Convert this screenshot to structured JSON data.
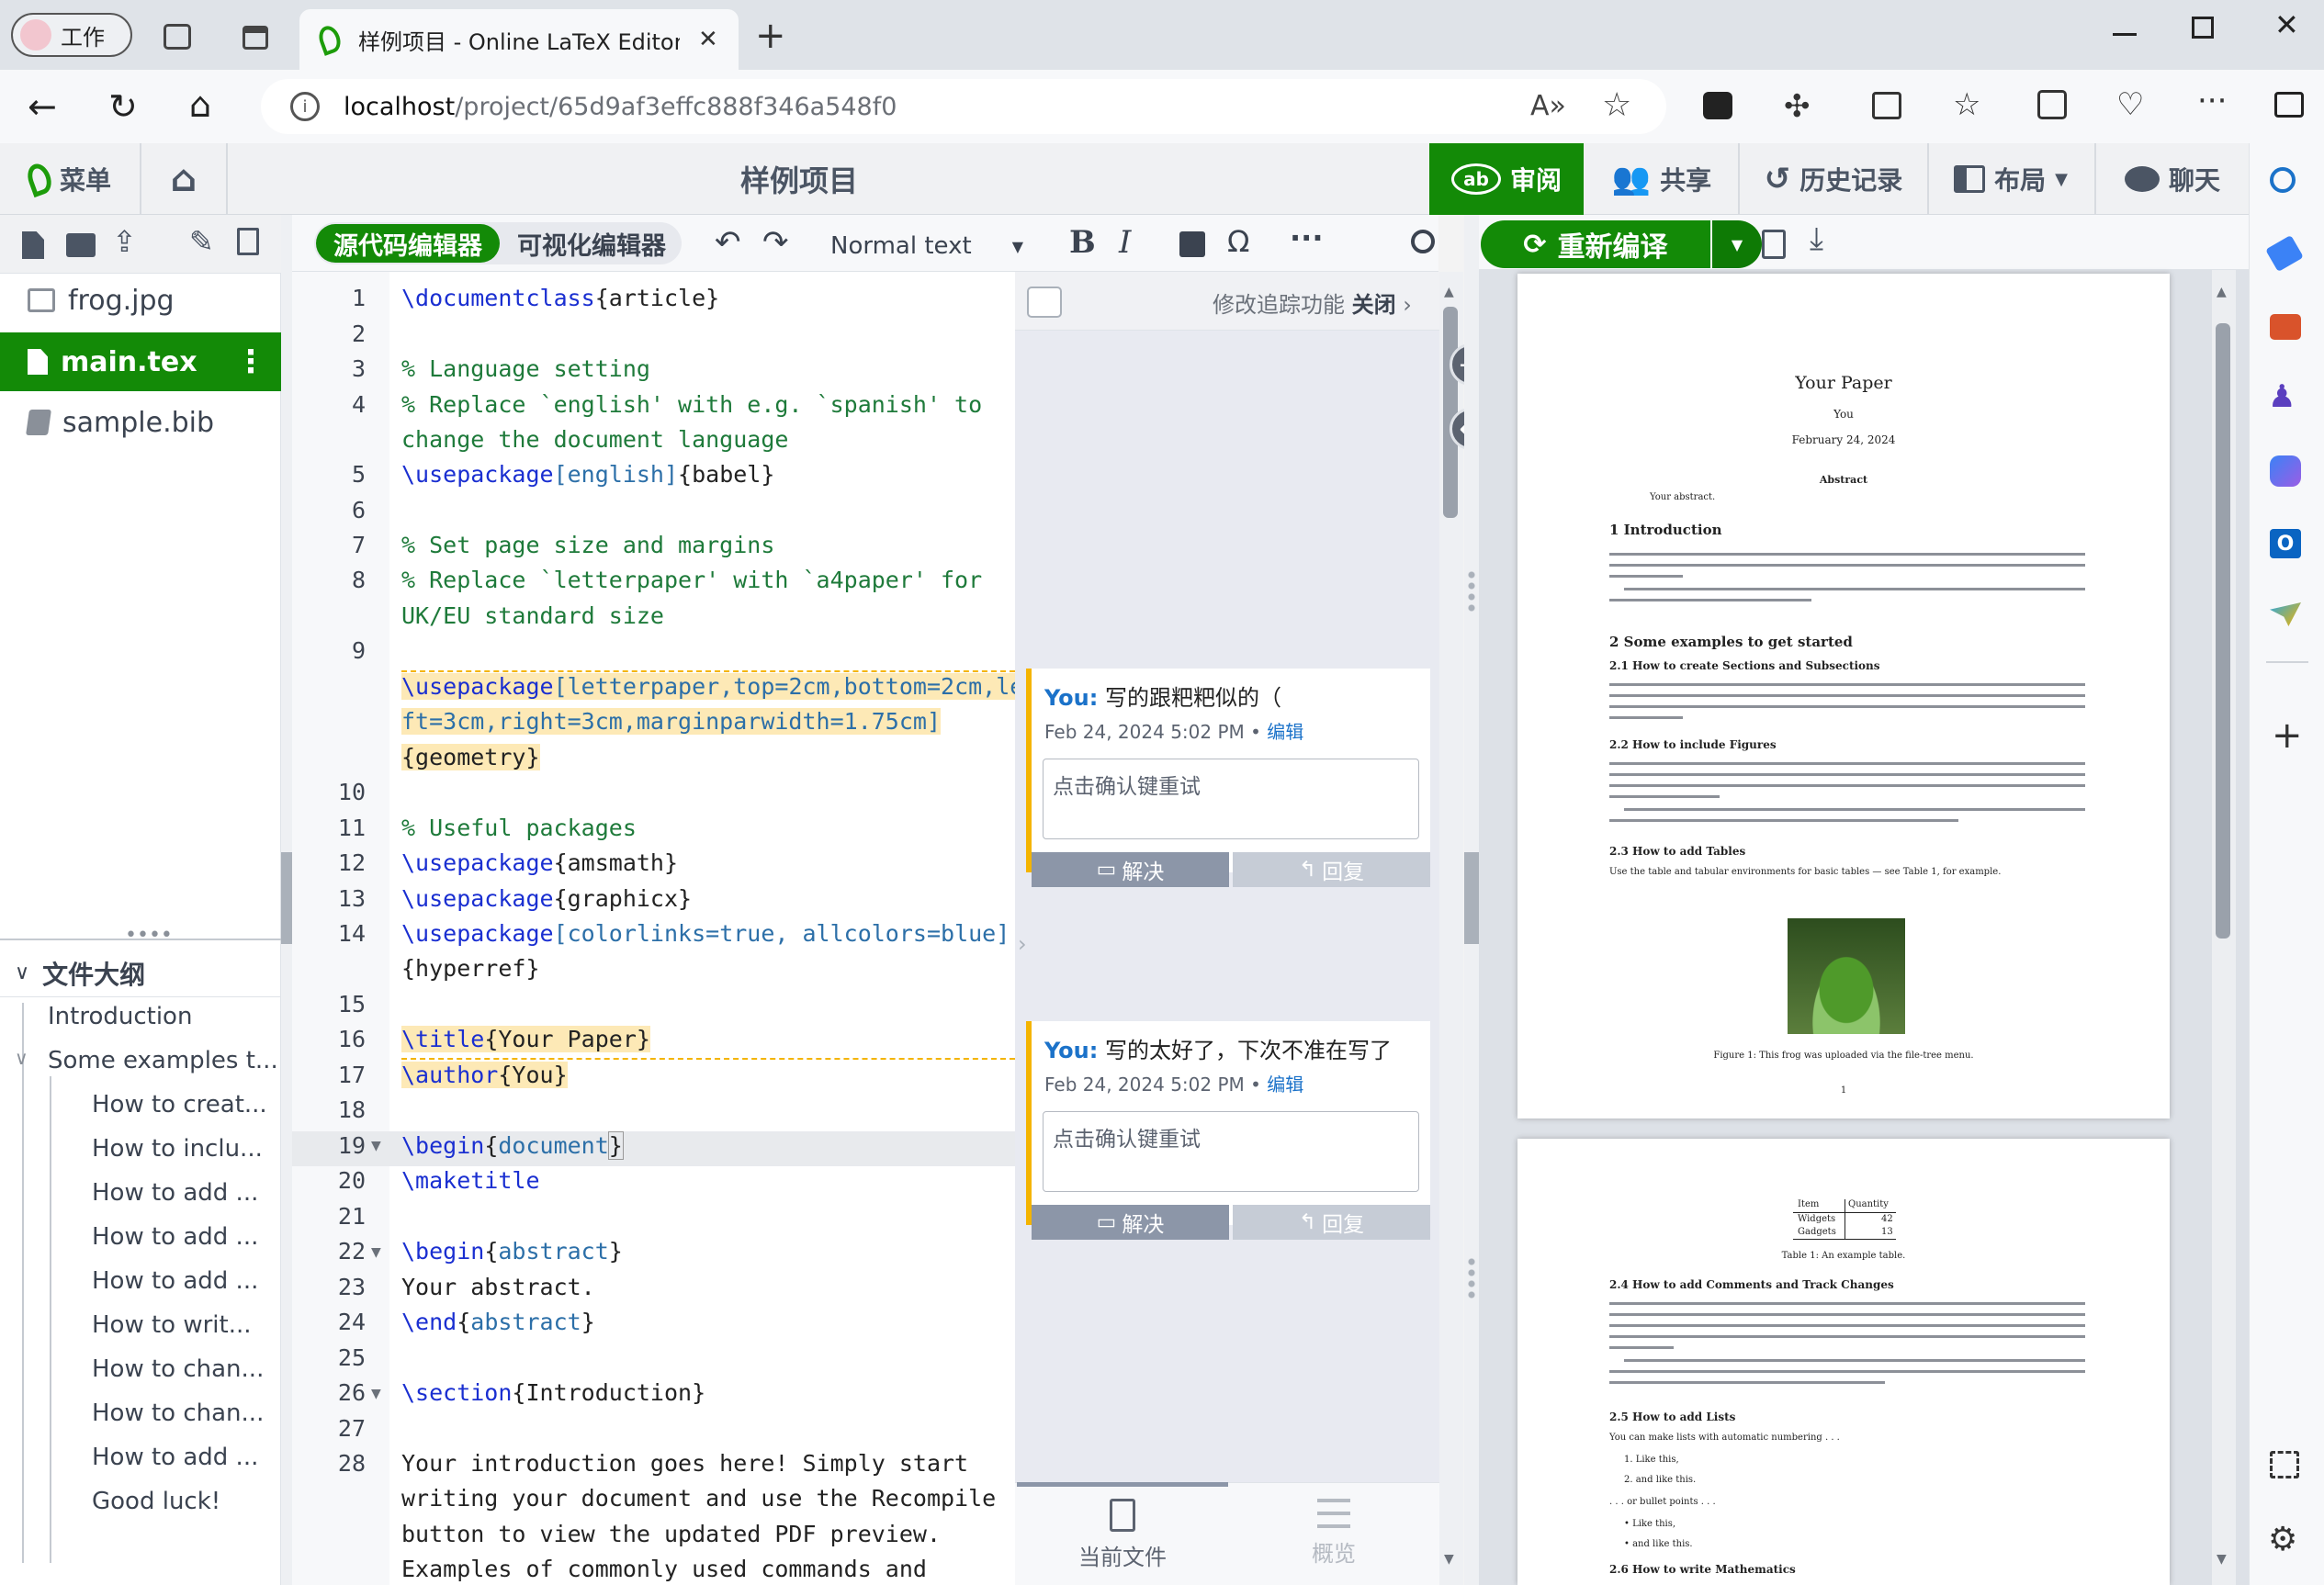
{
  "browser": {
    "workspace_label": "工作",
    "tab_title": "样例项目 - Online LaTeX Editor O",
    "url_host": "localhost",
    "url_path": "/project/65d9af3effc888f346a548f0"
  },
  "topbar": {
    "menu_label": "菜单",
    "project_title": "样例项目",
    "review_label": "审阅",
    "share_label": "共享",
    "history_label": "历史记录",
    "layout_label": "布局",
    "chat_label": "聊天"
  },
  "files": [
    {
      "name": "frog.jpg"
    },
    {
      "name": "main.tex"
    },
    {
      "name": "sample.bib"
    }
  ],
  "outline": {
    "title": "文件大纲",
    "items": [
      "Introduction",
      "Some examples t...",
      "How to creat...",
      "How to inclu...",
      "How to add ...",
      "How to add ...",
      "How to add ...",
      "How to writ...",
      "How to chan...",
      "How to chan...",
      "How to add ...",
      "Good luck!"
    ]
  },
  "editor": {
    "mode_source": "源代码编辑器",
    "mode_visual": "可视化编辑器",
    "style_select": "Normal text",
    "line_numbers": [
      "1",
      "2",
      "3",
      "4",
      "5",
      "6",
      "7",
      "8",
      "9",
      "10",
      "11",
      "12",
      "13",
      "14",
      "15",
      "16",
      "17",
      "18",
      "19",
      "20",
      "21",
      "22",
      "23",
      "24",
      "25",
      "26",
      "27",
      "28"
    ],
    "code": {
      "l1a": "\\documentclass",
      "l1b": "{article}",
      "l3": "% Language setting",
      "l4a": "% Replace `english' with e.g. `spanish' to",
      "l4b": "change the document language",
      "l5a": "\\usepackage",
      "l5b": "[english]",
      "l5c": "{babel}",
      "l7": "% Set page size and margins",
      "l8a": "% Replace `letterpaper' with `a4paper' for",
      "l8b": "UK/EU standard size",
      "l9a": "\\usepackage",
      "l9b": "[letterpaper,top=2cm,bottom=2cm,le",
      "l9c": "ft=3cm,right=3cm,marginparwidth=1.75cm]",
      "l9d": "{geometry}",
      "l11": "% Useful packages",
      "l12a": "\\usepackage",
      "l12b": "{amsmath}",
      "l13a": "\\usepackage",
      "l13b": "{graphicx}",
      "l14a": "\\usepackage",
      "l14b": "[colorlinks=true, allcolors=blue]",
      "l14c": "{hyperref}",
      "l16a": "\\title",
      "l16b": "{Your Paper}",
      "l17a": "\\author",
      "l17b": "{You}",
      "l19a": "\\begin",
      "l19b": "{",
      "l19c": "document",
      "l19d": "}",
      "l20": "\\maketitle",
      "l22a": "\\begin",
      "l22b": "{",
      "l22c": "abstract",
      "l22d": "}",
      "l23": "Your abstract.",
      "l24a": "\\end",
      "l24b": "{",
      "l24c": "abstract",
      "l24d": "}",
      "l26a": "\\section",
      "l26b": "{Introduction}",
      "l28a": "Your introduction goes here! Simply start",
      "l28b": "writing your document and use the Recompile",
      "l28c": "button to view the updated PDF preview.",
      "l28d": "Examples of commonly used commands and"
    }
  },
  "review": {
    "track_changes": "修改追踪功能",
    "track_state": "关闭",
    "comments": [
      {
        "author": "You:",
        "text": "写的跟粑粑似的（",
        "date": "Feb 24, 2024 5:02 PM",
        "edit": "编辑",
        "placeholder": "点击确认键重试",
        "resolve": "解决",
        "reply": "回复"
      },
      {
        "author": "You:",
        "text": "写的太好了，下次不准在写了",
        "date": "Feb 24, 2024 5:02 PM",
        "edit": "编辑",
        "placeholder": "点击确认键重试",
        "resolve": "解决",
        "reply": "回复"
      }
    ],
    "tab_current": "当前文件",
    "tab_overview": "概览"
  },
  "pdf": {
    "recompile": "重新编译",
    "p1": {
      "title": "Your Paper",
      "author": "You",
      "date": "February 24, 2024",
      "abstract_h": "Abstract",
      "abstract": "Your abstract.",
      "s1": "1 Introduction",
      "s2": "2 Some examples to get started",
      "s21": "2.1 How to create Sections and Subsections",
      "s22": "2.2 How to include Figures",
      "s23": "2.3 How to add Tables",
      "s23t": "Use the table and tabular environments for basic tables — see Table 1, for example.",
      "fig": "Figure 1: This frog was uploaded via the file-tree menu.",
      "pageno": "1"
    },
    "p2": {
      "th1": "Item",
      "th2": "Quantity",
      "r1a": "Widgets",
      "r1b": "42",
      "r2a": "Gadgets",
      "r2b": "13",
      "cap": "Table 1: An example table.",
      "s24": "2.4 How to add Comments and Track Changes",
      "s25": "2.5 How to add Lists",
      "s25t": "You can make lists with automatic numbering . . .",
      "li1": "1. Like this,",
      "li2": "2. and like this.",
      "bul": ". . . or bullet points . . .",
      "bl1": "• Like this,",
      "bl2": "• and like this.",
      "s26": "2.6 How to write Mathematics"
    }
  },
  "colors": {
    "green": "#138a07",
    "brand_green": "#1d9c0a",
    "tab_green": "#0e7a05",
    "track_yellow": "#f4b400",
    "link_blue": "#1b72c9"
  }
}
